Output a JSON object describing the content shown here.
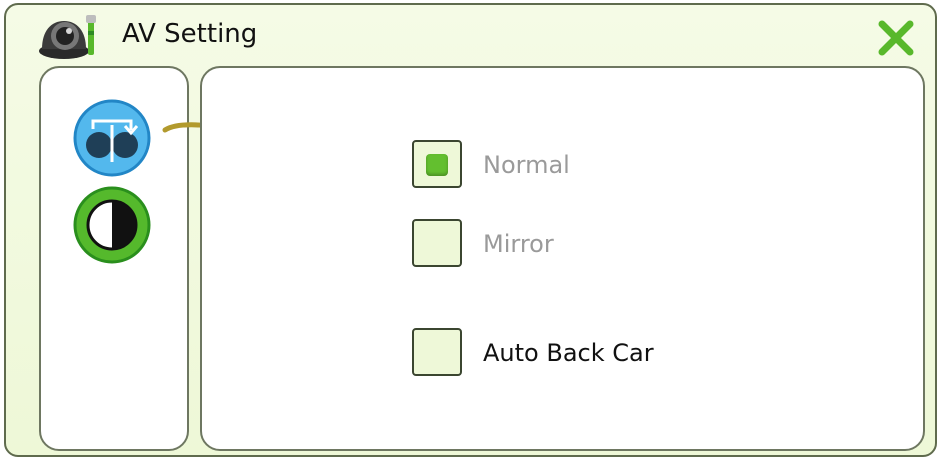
{
  "window": {
    "title": "AV Setting",
    "title_icon": "camera-wrench-icon",
    "close_icon": "close-icon"
  },
  "sidebar": {
    "items": [
      {
        "icon": "mirror-flip-icon",
        "state": "selected"
      },
      {
        "icon": "contrast-icon",
        "state": "normal"
      }
    ]
  },
  "options": [
    {
      "label": "Normal",
      "checked": true,
      "enabled": false
    },
    {
      "label": "Mirror",
      "checked": false,
      "enabled": false
    },
    {
      "label": "Auto Back Car",
      "checked": false,
      "enabled": true
    }
  ],
  "colors": {
    "accent_green": "#63bf2f",
    "close_green": "#58b82b",
    "selected_blue": "#53b8ed",
    "contrast_green": "#55b92c",
    "panel_border": "#6e7761"
  }
}
